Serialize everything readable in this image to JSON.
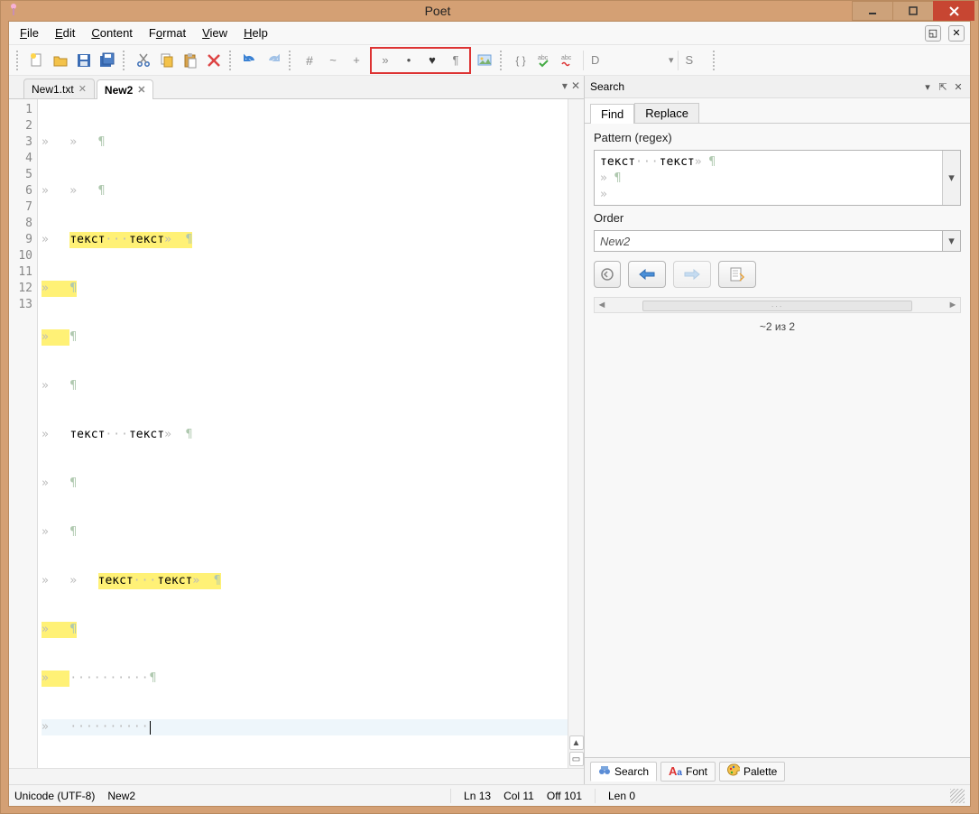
{
  "window": {
    "title": "Poet"
  },
  "menu": {
    "file": "File",
    "edit": "Edit",
    "content": "Content",
    "format": "Format",
    "view": "View",
    "help": "Help"
  },
  "toolbar": {
    "field_d": "D",
    "field_s": "S"
  },
  "tabs": {
    "items": [
      {
        "label": "New1.txt",
        "active": false
      },
      {
        "label": "New2",
        "active": true
      }
    ]
  },
  "editor": {
    "line_count": 13,
    "lines": {
      "l3": {
        "t1": "текст",
        "t2": "текст"
      },
      "l7": {
        "t1": "текст",
        "t2": "текст"
      },
      "l10": {
        "t1": "текст",
        "t2": "текст"
      }
    }
  },
  "search": {
    "panel_title": "Search",
    "tabs": {
      "find": "Find",
      "replace": "Replace"
    },
    "pattern_label": "Pattern (regex)",
    "pattern_value": {
      "t1": "текст",
      "t2": "текст"
    },
    "order_label": "Order",
    "order_value": "New2",
    "results": "~2 из 2"
  },
  "footer_tabs": {
    "search": "Search",
    "font": "Font",
    "palette": "Palette"
  },
  "status": {
    "encoding": "Unicode (UTF-8)",
    "doc": "New2",
    "ln": "Ln 13",
    "col": "Col 11",
    "off": "Off 101",
    "len": "Len 0"
  }
}
